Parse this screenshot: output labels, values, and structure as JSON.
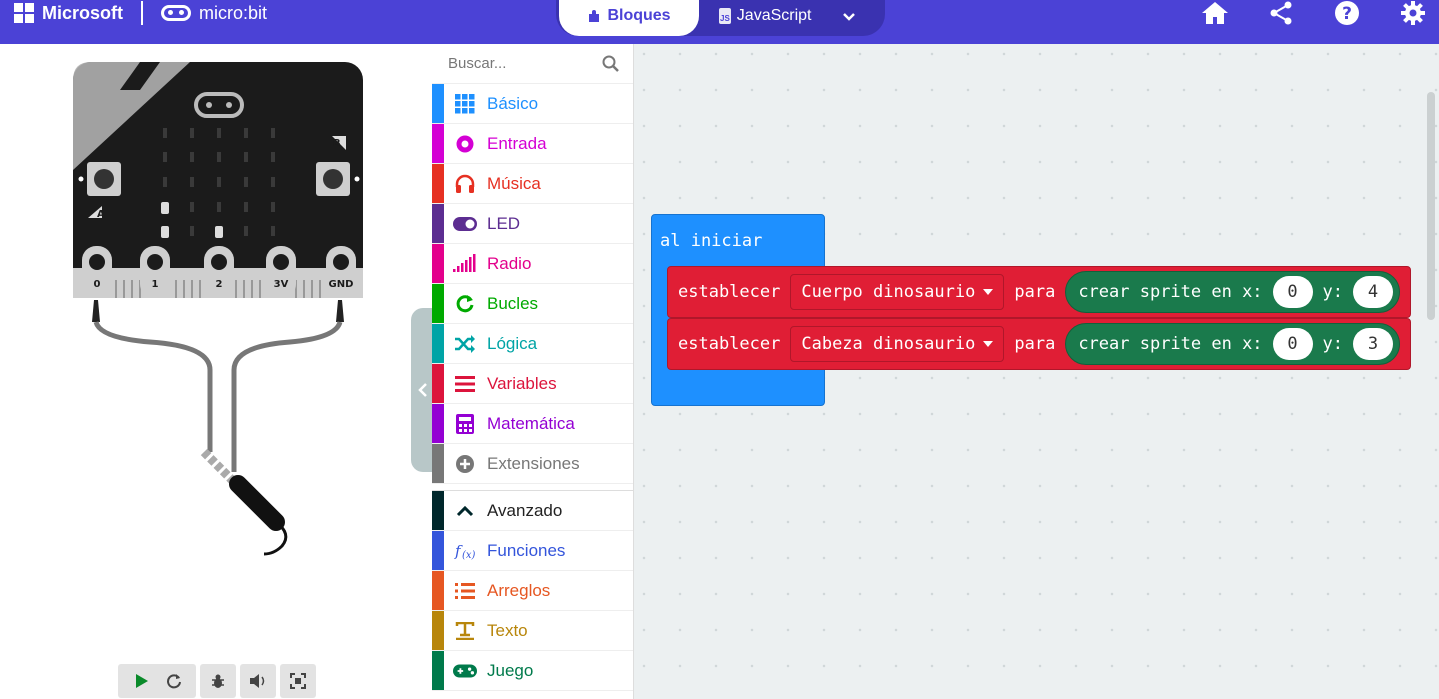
{
  "header": {
    "microsoft_label": "Microsoft",
    "microbit_label": "micro:bit",
    "tab_blocks": "Bloques",
    "tab_js": "JavaScript",
    "js_badge": "JS"
  },
  "colors": {
    "accent": "#4b42d6"
  },
  "simulator": {
    "pins": [
      "0",
      "1",
      "2",
      "3V",
      "GND"
    ],
    "button_a": "A",
    "button_b": "B"
  },
  "toolbox": {
    "search_placeholder": "Buscar...",
    "categories": [
      {
        "label": "Básico",
        "color": "#1e90ff",
        "icon": "grid-icon"
      },
      {
        "label": "Entrada",
        "color": "#d400d4",
        "icon": "target-icon"
      },
      {
        "label": "Música",
        "color": "#e63022",
        "icon": "headphones-icon"
      },
      {
        "label": "LED",
        "color": "#5c2d91",
        "icon": "toggle-icon"
      },
      {
        "label": "Radio",
        "color": "#e3008c",
        "icon": "signal-icon"
      },
      {
        "label": "Bucles",
        "color": "#00aa00",
        "icon": "refresh-icon"
      },
      {
        "label": "Lógica",
        "color": "#00a4a6",
        "icon": "shuffle-icon"
      },
      {
        "label": "Variables",
        "color": "#dc143c",
        "icon": "list-icon"
      },
      {
        "label": "Matemática",
        "color": "#9400d3",
        "icon": "calculator-icon"
      },
      {
        "label": "Extensiones",
        "color": "#777777",
        "icon": "plus-circle-icon"
      }
    ],
    "advanced": [
      {
        "label": "Avanzado",
        "color": "#00272b",
        "icon": "chevron-up-icon"
      },
      {
        "label": "Funciones",
        "color": "#3455db",
        "icon": "function-icon"
      },
      {
        "label": "Arreglos",
        "color": "#e65722",
        "icon": "numbered-list-icon"
      },
      {
        "label": "Texto",
        "color": "#b8860b",
        "icon": "text-icon"
      },
      {
        "label": "Juego",
        "color": "#007a4b",
        "icon": "gamepad-icon"
      }
    ]
  },
  "workspace": {
    "hat_label": "al iniciar",
    "statements": [
      {
        "keyword": "establecer",
        "variable": "Cuerpo dinosaurio",
        "para": "para",
        "sprite_label": "crear sprite en x:",
        "y_label": "y:",
        "x": "0",
        "y": "4"
      },
      {
        "keyword": "establecer",
        "variable": "Cabeza dinosaurio",
        "para": "para",
        "sprite_label": "crear sprite en x:",
        "y_label": "y:",
        "x": "0",
        "y": "3"
      }
    ]
  }
}
